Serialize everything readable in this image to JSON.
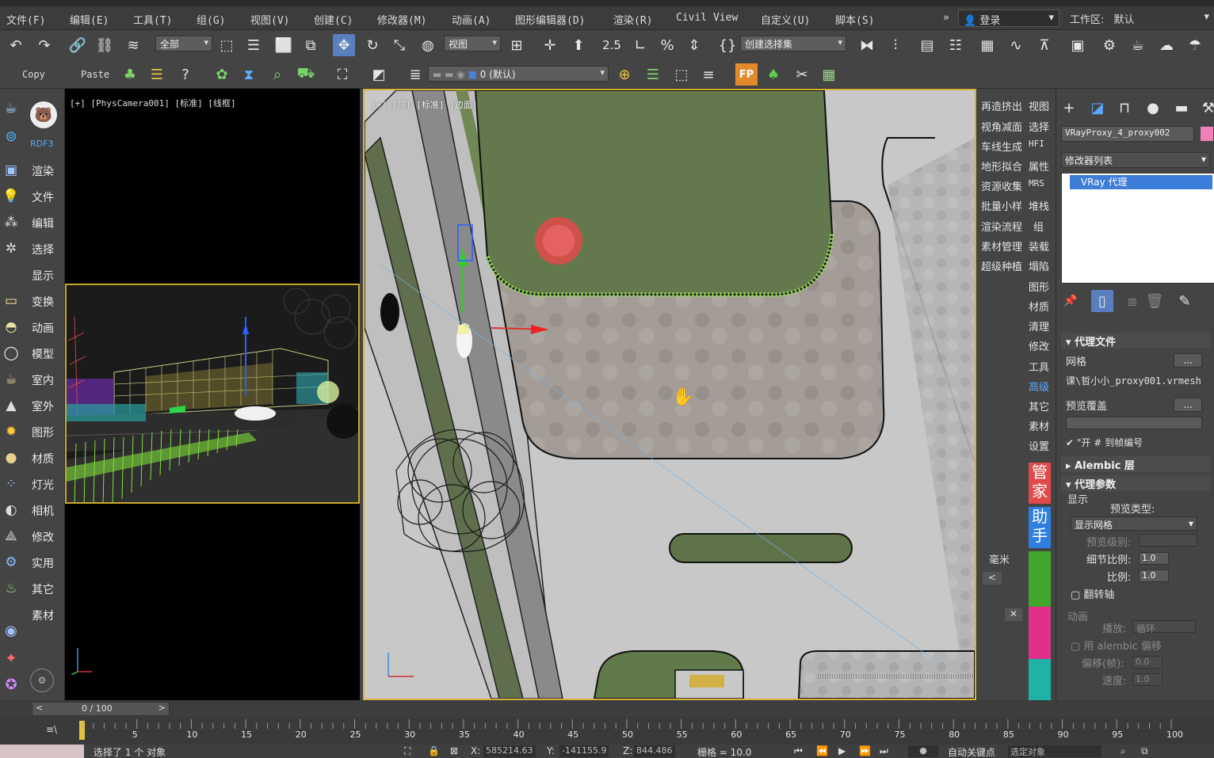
{
  "menu": {
    "items": [
      "文件(F)",
      "编辑(E)",
      "工具(T)",
      "组(G)",
      "视图(V)",
      "创建(C)",
      "修改器(M)",
      "动画(A)",
      "图形编辑器(D)",
      "渲染(R)",
      "Civil View",
      "自定义(U)",
      "脚本(S)"
    ],
    "login": "登录",
    "workspace_label": "工作区:",
    "workspace_value": "默认"
  },
  "toolbar1": {
    "filter_dropdown": "全部",
    "coord_dropdown": "视图",
    "selection_set": "创建选择集",
    "snap_number": "2.5"
  },
  "toolbar2": {
    "copy_label": "Copy",
    "paste_label": "Paste",
    "layer_value": "0 (默认)"
  },
  "leftbar": {
    "top_label": "RDF3",
    "items": [
      "渲染",
      "文件",
      "编辑",
      "选择",
      "显示",
      "变换",
      "动画",
      "模型",
      "室内",
      "室外",
      "图形",
      "材质",
      "灯光",
      "相机",
      "修改",
      "实用",
      "其它",
      "素材"
    ]
  },
  "viewports": {
    "camera_label": "[+] [PhysCamera001] [标准] [线框]",
    "top_label": "[+] [顶] [标准] [边面]"
  },
  "pluginbar": {
    "col_a": [
      "再造挤出",
      "视角减面",
      "车线生成",
      "地形拟合",
      "资源收集",
      "批量小样",
      "渲染流程",
      "素材管理",
      "超级种植"
    ],
    "col_b": [
      "视图",
      "选择",
      "HFI",
      "属性",
      "MRS",
      "堆栈",
      "组",
      "装载",
      "塌陷",
      "图形",
      "材质",
      "清理",
      "修改",
      "工具",
      "高级",
      "其它",
      "素材",
      "设置"
    ],
    "badge_guanjia": "管家",
    "badge_zhushou": "助手",
    "unit_label": "毫米"
  },
  "cmdpanel": {
    "object_name": "VRayProxy_4_proxy002",
    "modifier_list": "修改器列表",
    "stack_item": "VRay 代理",
    "proxy_file_section": "代理文件",
    "mesh_label": "网格",
    "mesh_path": "课\\晢小小_proxy001.vrmesh",
    "preview_override": "预览覆盖",
    "frame_check": "\"开 # 到帧编号",
    "alembic_section": "Alembic 层",
    "proxy_params_section": "代理参数",
    "display_label": "显示",
    "preview_type_label": "预览类型:",
    "preview_type_value": "显示网格",
    "preview_level_label": "预览级别:",
    "detail_ratio_label": "细节比例:",
    "detail_ratio_value": "1.0",
    "scale_label": "比例:",
    "scale_value": "1.0",
    "flip_axis": "翻转轴",
    "anim_label": "动画",
    "playback_label": "播放:",
    "playback_value": "循环",
    "alembic_offset": "用 alembic 偏移",
    "offset_label": "偏移(帧):",
    "offset_value": "0.0",
    "speed_label": "速度:",
    "speed_value": "1.0"
  },
  "timeline": {
    "frame_counter": "0 / 100",
    "ticks": [
      "5",
      "10",
      "15",
      "20",
      "25",
      "30",
      "35",
      "40",
      "45",
      "50",
      "55",
      "60",
      "65",
      "70",
      "75",
      "80",
      "85",
      "90",
      "95",
      "100"
    ]
  },
  "statusbar": {
    "selection_text": "选择了 1 个 对象",
    "x_value": "585214.63",
    "y_value": "-141155.9",
    "z_value": "844.486",
    "grid_label": "栅格 = 10.0",
    "auto_key": "自动关键点",
    "selected_object": "选定对象"
  },
  "colors": {
    "accent_blue": "#5a7fbf",
    "viewport_border": "#d6b33a",
    "badge_red": "#e04a4a",
    "badge_blue": "#2f7fe0",
    "swatch_pink": "#f080b8"
  }
}
